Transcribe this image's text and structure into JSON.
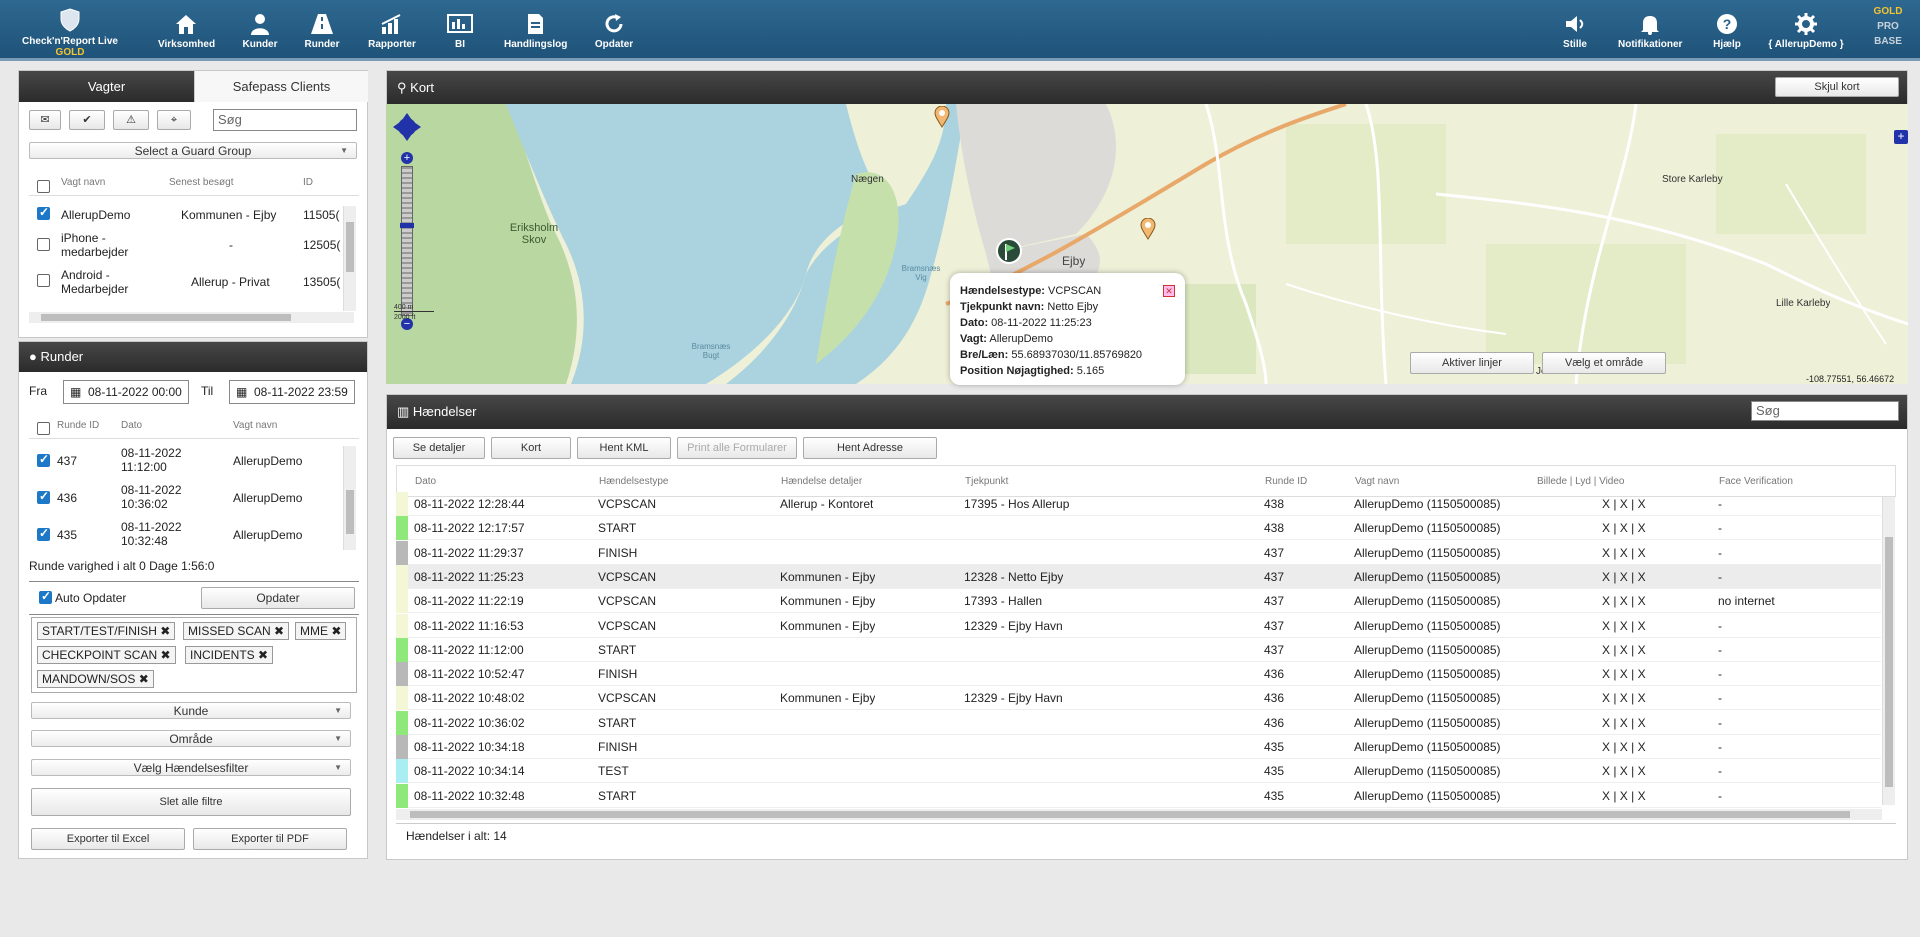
{
  "nav": {
    "brand": "Check'n'Report Live",
    "brand_tier": "GOLD",
    "items": [
      {
        "label": "Virksomhed",
        "icon": "home-icon"
      },
      {
        "label": "Kunder",
        "icon": "user-icon"
      },
      {
        "label": "Runder",
        "icon": "road-icon"
      },
      {
        "label": "Rapporter",
        "icon": "bar-chart-icon"
      },
      {
        "label": "BI",
        "icon": "dashboard-icon"
      },
      {
        "label": "Handlingslog",
        "icon": "log-icon"
      },
      {
        "label": "Opdater",
        "icon": "refresh-icon"
      }
    ],
    "right_items": [
      {
        "label": "Stille",
        "icon": "speaker-icon"
      },
      {
        "label": "Notifikationer",
        "icon": "bell-icon"
      },
      {
        "label": "Hjælp",
        "icon": "help-icon"
      },
      {
        "label": "{ AllerupDemo }",
        "icon": "gear-icon"
      }
    ],
    "tiers": [
      "GOLD",
      "PRO",
      "BASE"
    ]
  },
  "guards": {
    "tab_active": "Vagter",
    "tab_other": "Safepass Clients",
    "search_placeholder": "Søg",
    "group_select": "Select a Guard Group",
    "headers": [
      "Vagt navn",
      "Senest besøgt",
      "ID"
    ],
    "rows": [
      {
        "name": "AllerupDemo",
        "last": "Kommunen - Ejby",
        "id": "11505(",
        "checked": true
      },
      {
        "name": "iPhone - medarbejder",
        "last": "-",
        "id": "12505(",
        "checked": false
      },
      {
        "name": "Android - Medarbejder",
        "last": "Allerup - Privat",
        "id": "13505(",
        "checked": false
      }
    ]
  },
  "runder": {
    "title": "Runder",
    "from_label": "Fra",
    "from_value": "08-11-2022 00:00",
    "to_label": "Til",
    "to_value": "08-11-2022 23:59",
    "headers": [
      "Runde ID",
      "Dato",
      "Vagt navn"
    ],
    "rows": [
      {
        "id": "437",
        "date1": "08-11-2022",
        "date2": "11:12:00",
        "guard": "AllerupDemo"
      },
      {
        "id": "436",
        "date1": "08-11-2022",
        "date2": "10:36:02",
        "guard": "AllerupDemo"
      },
      {
        "id": "435",
        "date1": "08-11-2022",
        "date2": "10:32:48",
        "guard": "AllerupDemo"
      }
    ],
    "duration": "Runde varighed i alt 0 Dage 1:56:0",
    "auto_update": "Auto Opdater",
    "update_btn": "Opdater",
    "tags": [
      "START/TEST/FINISH",
      "MISSED SCAN",
      "MME",
      "CHECKPOINT SCAN",
      "INCIDENTS",
      "MANDOWN/SOS"
    ],
    "kunde": "Kunde",
    "omraade": "Område",
    "filter": "Vælg Hændelsesfilter",
    "clear": "Slet alle filtre",
    "excel": "Exporter til Excel",
    "pdf": "Exporter til PDF"
  },
  "map": {
    "title": "Kort",
    "hide_btn": "Skjul kort",
    "activate_lines": "Aktiver linjer",
    "choose_area": "Vælg et område",
    "coords": "-108.77551, 56.46672",
    "scale_m": "400 m",
    "scale_ft": "2000 ft",
    "labels": [
      "Nægen",
      "Eriksholm Skov",
      "Bramsnæs Vig",
      "Bramsnæs Bugt",
      "Ejby",
      "Store Karleby",
      "Lille Karleby",
      "Jenslev"
    ],
    "popup": {
      "type_label": "Hændelsestype:",
      "type": "VCPSCAN",
      "cp_label": "Tjekpunkt navn:",
      "cp": "Netto Ejby",
      "date_label": "Dato:",
      "date": "08-11-2022 11:25:23",
      "guard_label": "Vagt:",
      "guard": "AllerupDemo",
      "latlon_label": "Bre/Læn:",
      "latlon": "55.68937030/11.85769820",
      "acc_label": "Position Nøjagtighed:",
      "acc": "5.165"
    }
  },
  "events": {
    "title": "Hændelser",
    "search_placeholder": "Søg",
    "buttons": [
      "Se detaljer",
      "Kort",
      "Hent KML",
      "Print alle Formularer",
      "Hent Adresse"
    ],
    "headers": [
      "Dato",
      "Hændelsestype",
      "Hændelse detaljer",
      "Tjekpunkt",
      "Runde ID",
      "Vagt navn",
      "Billede | Lyd | Video",
      "Face Verification"
    ],
    "rows": [
      {
        "date": "08-11-2022 12:28:44",
        "type": "VCPSCAN",
        "detail": "Allerup - Kontoret",
        "cp": "17395 - Hos Allerup",
        "round": "438",
        "guard": "AllerupDemo (1150500085)",
        "media": "X | X | X",
        "face": "-",
        "color": "#f4f7d6"
      },
      {
        "date": "08-11-2022 12:17:57",
        "type": "START",
        "detail": "",
        "cp": "",
        "round": "438",
        "guard": "AllerupDemo (1150500085)",
        "media": "X | X | X",
        "face": "-",
        "color": "#8ee87a"
      },
      {
        "date": "08-11-2022 11:29:37",
        "type": "FINISH",
        "detail": "",
        "cp": "",
        "round": "437",
        "guard": "AllerupDemo (1150500085)",
        "media": "X | X | X",
        "face": "-",
        "color": "#b8b8b8"
      },
      {
        "date": "08-11-2022 11:25:23",
        "type": "VCPSCAN",
        "detail": "Kommunen - Ejby",
        "cp": "12328 - Netto Ejby",
        "round": "437",
        "guard": "AllerupDemo (1150500085)",
        "media": "X | X | X",
        "face": "-",
        "color": "#f4f7d6"
      },
      {
        "date": "08-11-2022 11:22:19",
        "type": "VCPSCAN",
        "detail": "Kommunen - Ejby",
        "cp": "17393 - Hallen",
        "round": "437",
        "guard": "AllerupDemo (1150500085)",
        "media": "X | X | X",
        "face": "no internet",
        "color": "#f4f7d6"
      },
      {
        "date": "08-11-2022 11:16:53",
        "type": "VCPSCAN",
        "detail": "Kommunen - Ejby",
        "cp": "12329 - Ejby Havn",
        "round": "437",
        "guard": "AllerupDemo (1150500085)",
        "media": "X | X | X",
        "face": "-",
        "color": "#f4f7d6"
      },
      {
        "date": "08-11-2022 11:12:00",
        "type": "START",
        "detail": "",
        "cp": "",
        "round": "437",
        "guard": "AllerupDemo (1150500085)",
        "media": "X | X | X",
        "face": "-",
        "color": "#8ee87a"
      },
      {
        "date": "08-11-2022 10:52:47",
        "type": "FINISH",
        "detail": "",
        "cp": "",
        "round": "436",
        "guard": "AllerupDemo (1150500085)",
        "media": "X | X | X",
        "face": "-",
        "color": "#b8b8b8"
      },
      {
        "date": "08-11-2022 10:48:02",
        "type": "VCPSCAN",
        "detail": "Kommunen - Ejby",
        "cp": "12329 - Ejby Havn",
        "round": "436",
        "guard": "AllerupDemo (1150500085)",
        "media": "X | X | X",
        "face": "-",
        "color": "#f4f7d6"
      },
      {
        "date": "08-11-2022 10:36:02",
        "type": "START",
        "detail": "",
        "cp": "",
        "round": "436",
        "guard": "AllerupDemo (1150500085)",
        "media": "X | X | X",
        "face": "-",
        "color": "#8ee87a"
      },
      {
        "date": "08-11-2022 10:34:18",
        "type": "FINISH",
        "detail": "",
        "cp": "",
        "round": "435",
        "guard": "AllerupDemo (1150500085)",
        "media": "X | X | X",
        "face": "-",
        "color": "#b8b8b8"
      },
      {
        "date": "08-11-2022 10:34:14",
        "type": "TEST",
        "detail": "",
        "cp": "",
        "round": "435",
        "guard": "AllerupDemo (1150500085)",
        "media": "X | X | X",
        "face": "-",
        "color": "#a8eef2"
      },
      {
        "date": "08-11-2022 10:32:48",
        "type": "START",
        "detail": "",
        "cp": "",
        "round": "435",
        "guard": "AllerupDemo (1150500085)",
        "media": "X | X | X",
        "face": "-",
        "color": "#8ee87a"
      }
    ],
    "total": "Hændelser i alt: 14"
  }
}
